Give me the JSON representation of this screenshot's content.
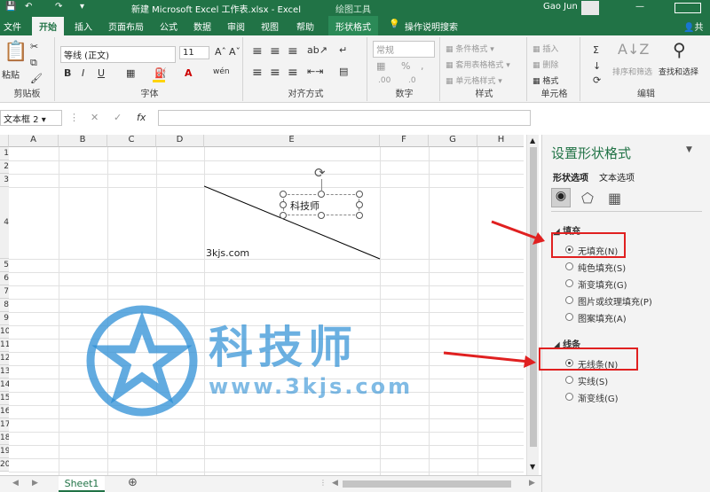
{
  "title": {
    "file": "新建 Microsoft Excel 工作表.xlsx  -  Excel",
    "context_tool": "绘图工具",
    "user": "Gao Jun"
  },
  "tabs": [
    "文件",
    "开始",
    "插入",
    "页面布局",
    "公式",
    "数据",
    "审阅",
    "视图",
    "帮助",
    "形状格式"
  ],
  "active_tab": "开始",
  "tell_me": "操作说明搜索",
  "share": "共",
  "ribbon": {
    "clipboard": {
      "paste": "粘贴",
      "label": "剪贴板"
    },
    "font": {
      "name": "等线 (正文)",
      "size": "11",
      "bold": "B",
      "italic": "I",
      "underline": "U",
      "label": "字体"
    },
    "align": {
      "label": "对齐方式"
    },
    "number": {
      "format": "常规",
      "label": "数字"
    },
    "styles": {
      "cond": "条件格式",
      "table": "套用表格格式",
      "cell": "单元格样式",
      "label": "样式"
    },
    "cells": {
      "insert": "插入",
      "delete": "删除",
      "format": "格式",
      "label": "单元格"
    },
    "edit": {
      "sort": "排序和筛选",
      "find": "查找和选择",
      "label": "编辑"
    }
  },
  "namebox": "文本框 2",
  "fx": "fx",
  "columns": [
    "A",
    "B",
    "C",
    "D",
    "E",
    "F",
    "G",
    "H"
  ],
  "rows": [
    "1",
    "2",
    "3",
    "4",
    "5",
    "6",
    "7",
    "8",
    "9",
    "10",
    "11",
    "12",
    "13",
    "14",
    "15",
    "16",
    "17",
    "18",
    "19",
    "20"
  ],
  "cells": {
    "textbox": "科技师",
    "d4": "3kjs.com"
  },
  "watermark": {
    "cn": "科技师",
    "url": "www.3kjs.com"
  },
  "sheet_tab": "Sheet1",
  "pane": {
    "title": "设置形状格式",
    "tabs": [
      "形状选项",
      "文本选项"
    ],
    "fill": {
      "header": "填充",
      "options": [
        "无填充(N)",
        "纯色填充(S)",
        "渐变填充(G)",
        "图片或纹理填充(P)",
        "图案填充(A)"
      ],
      "selected": 0
    },
    "line": {
      "header": "线条",
      "options": [
        "无线条(N)",
        "实线(S)",
        "渐变线(G)"
      ],
      "selected": 0
    }
  },
  "colors": {
    "brand": "#217346",
    "arrow": "#e02020",
    "watermark": "#2d8fd5"
  }
}
